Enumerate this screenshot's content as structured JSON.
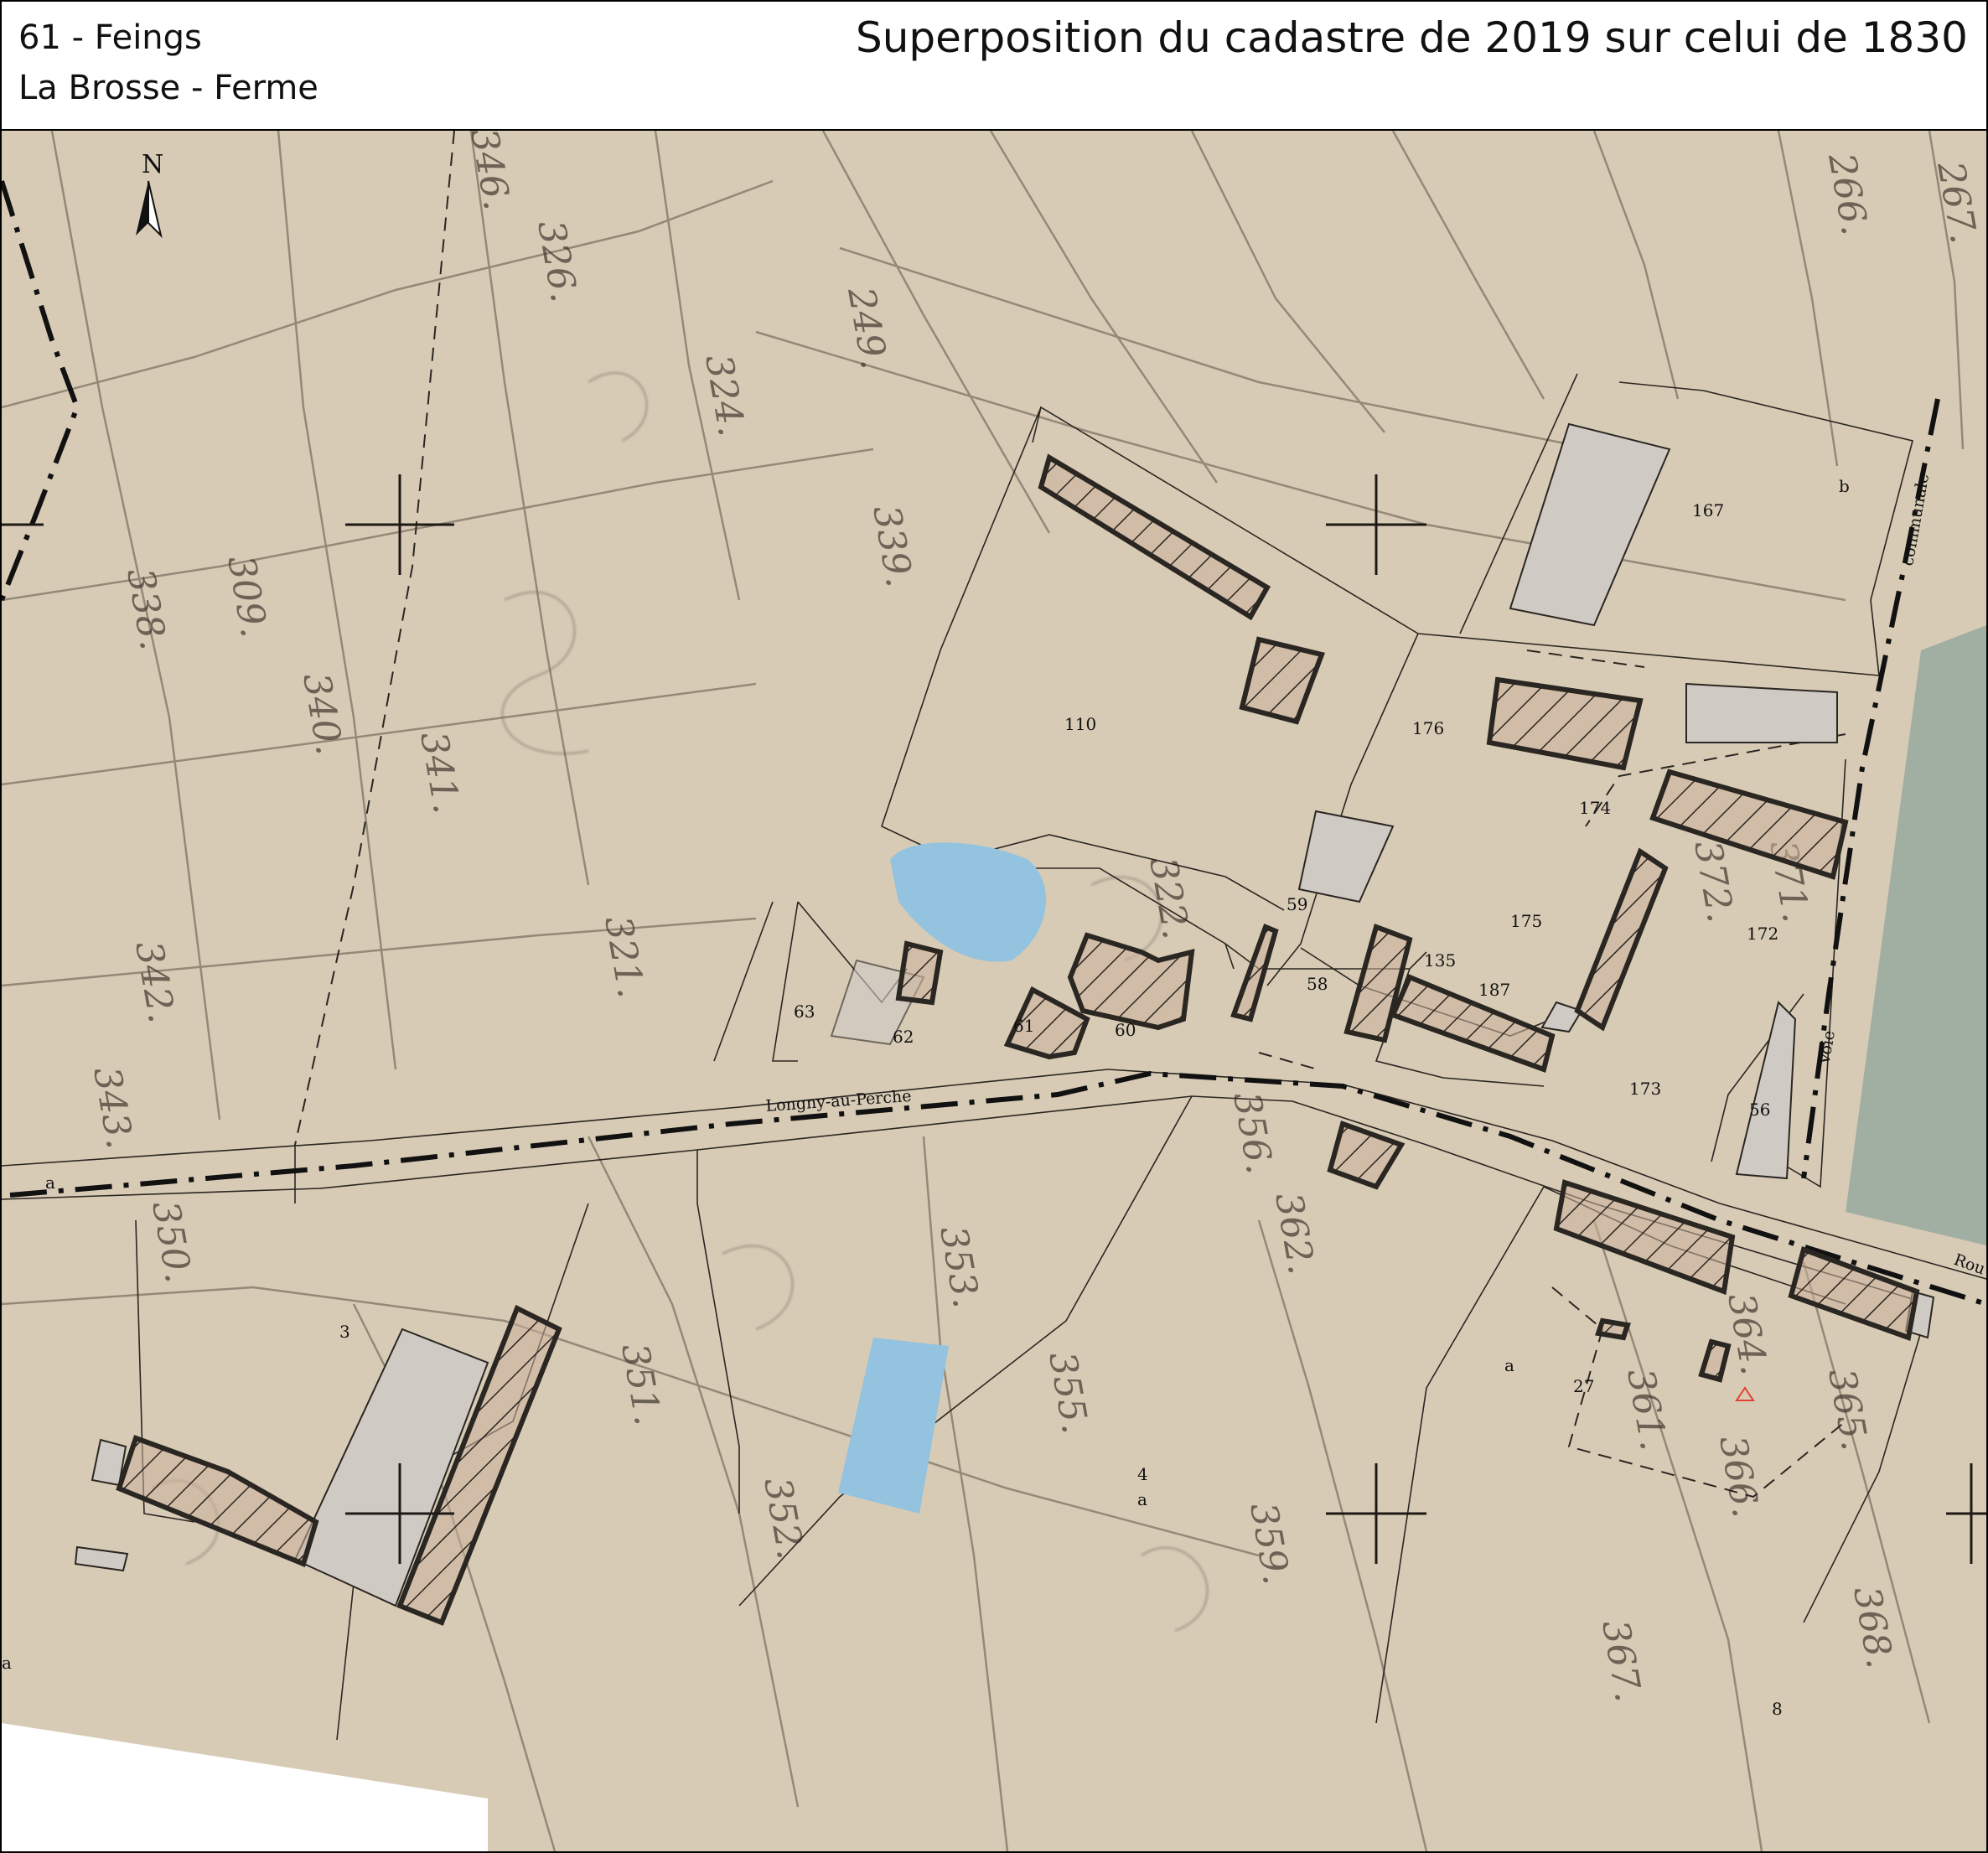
{
  "header": {
    "commune": "61 - Feings",
    "place": "La Brosse - Ferme",
    "title": "Superposition du cadastre de 2019 sur celui de 1830"
  },
  "north_arrow": {
    "label": "N"
  },
  "colors": {
    "paper": "#d8cbb6",
    "water": "#93c3de",
    "building_2019_fill": "#cfcac4",
    "hatch_stroke": "#2b2520",
    "road_boundary": "#111111",
    "stream_strip": "#8fa69c"
  },
  "parcels_2019": [
    "3",
    "4",
    "8",
    "27",
    "56",
    "58",
    "59",
    "60",
    "61",
    "62",
    "63",
    "110",
    "135",
    "167",
    "172",
    "173",
    "174",
    "175",
    "176",
    "187"
  ],
  "section_letters": [
    "a",
    "a",
    "a",
    "a",
    "b"
  ],
  "road_labels": {
    "longny": "Longny-au-Perche",
    "voie": "Voie",
    "communale": "communale",
    "route": "Rou"
  },
  "old_parcels_1830": [
    "338.",
    "339.",
    "340.",
    "341.",
    "342.",
    "343.",
    "321.",
    "322.",
    "324.",
    "326.",
    "346.",
    "351.",
    "352.",
    "353.",
    "355.",
    "356.",
    "359.",
    "361.",
    "362.",
    "364.",
    "365.",
    "366.",
    "367.",
    "368.",
    "266.",
    "267.",
    "249.",
    "350.",
    "371.",
    "372.",
    "309."
  ]
}
